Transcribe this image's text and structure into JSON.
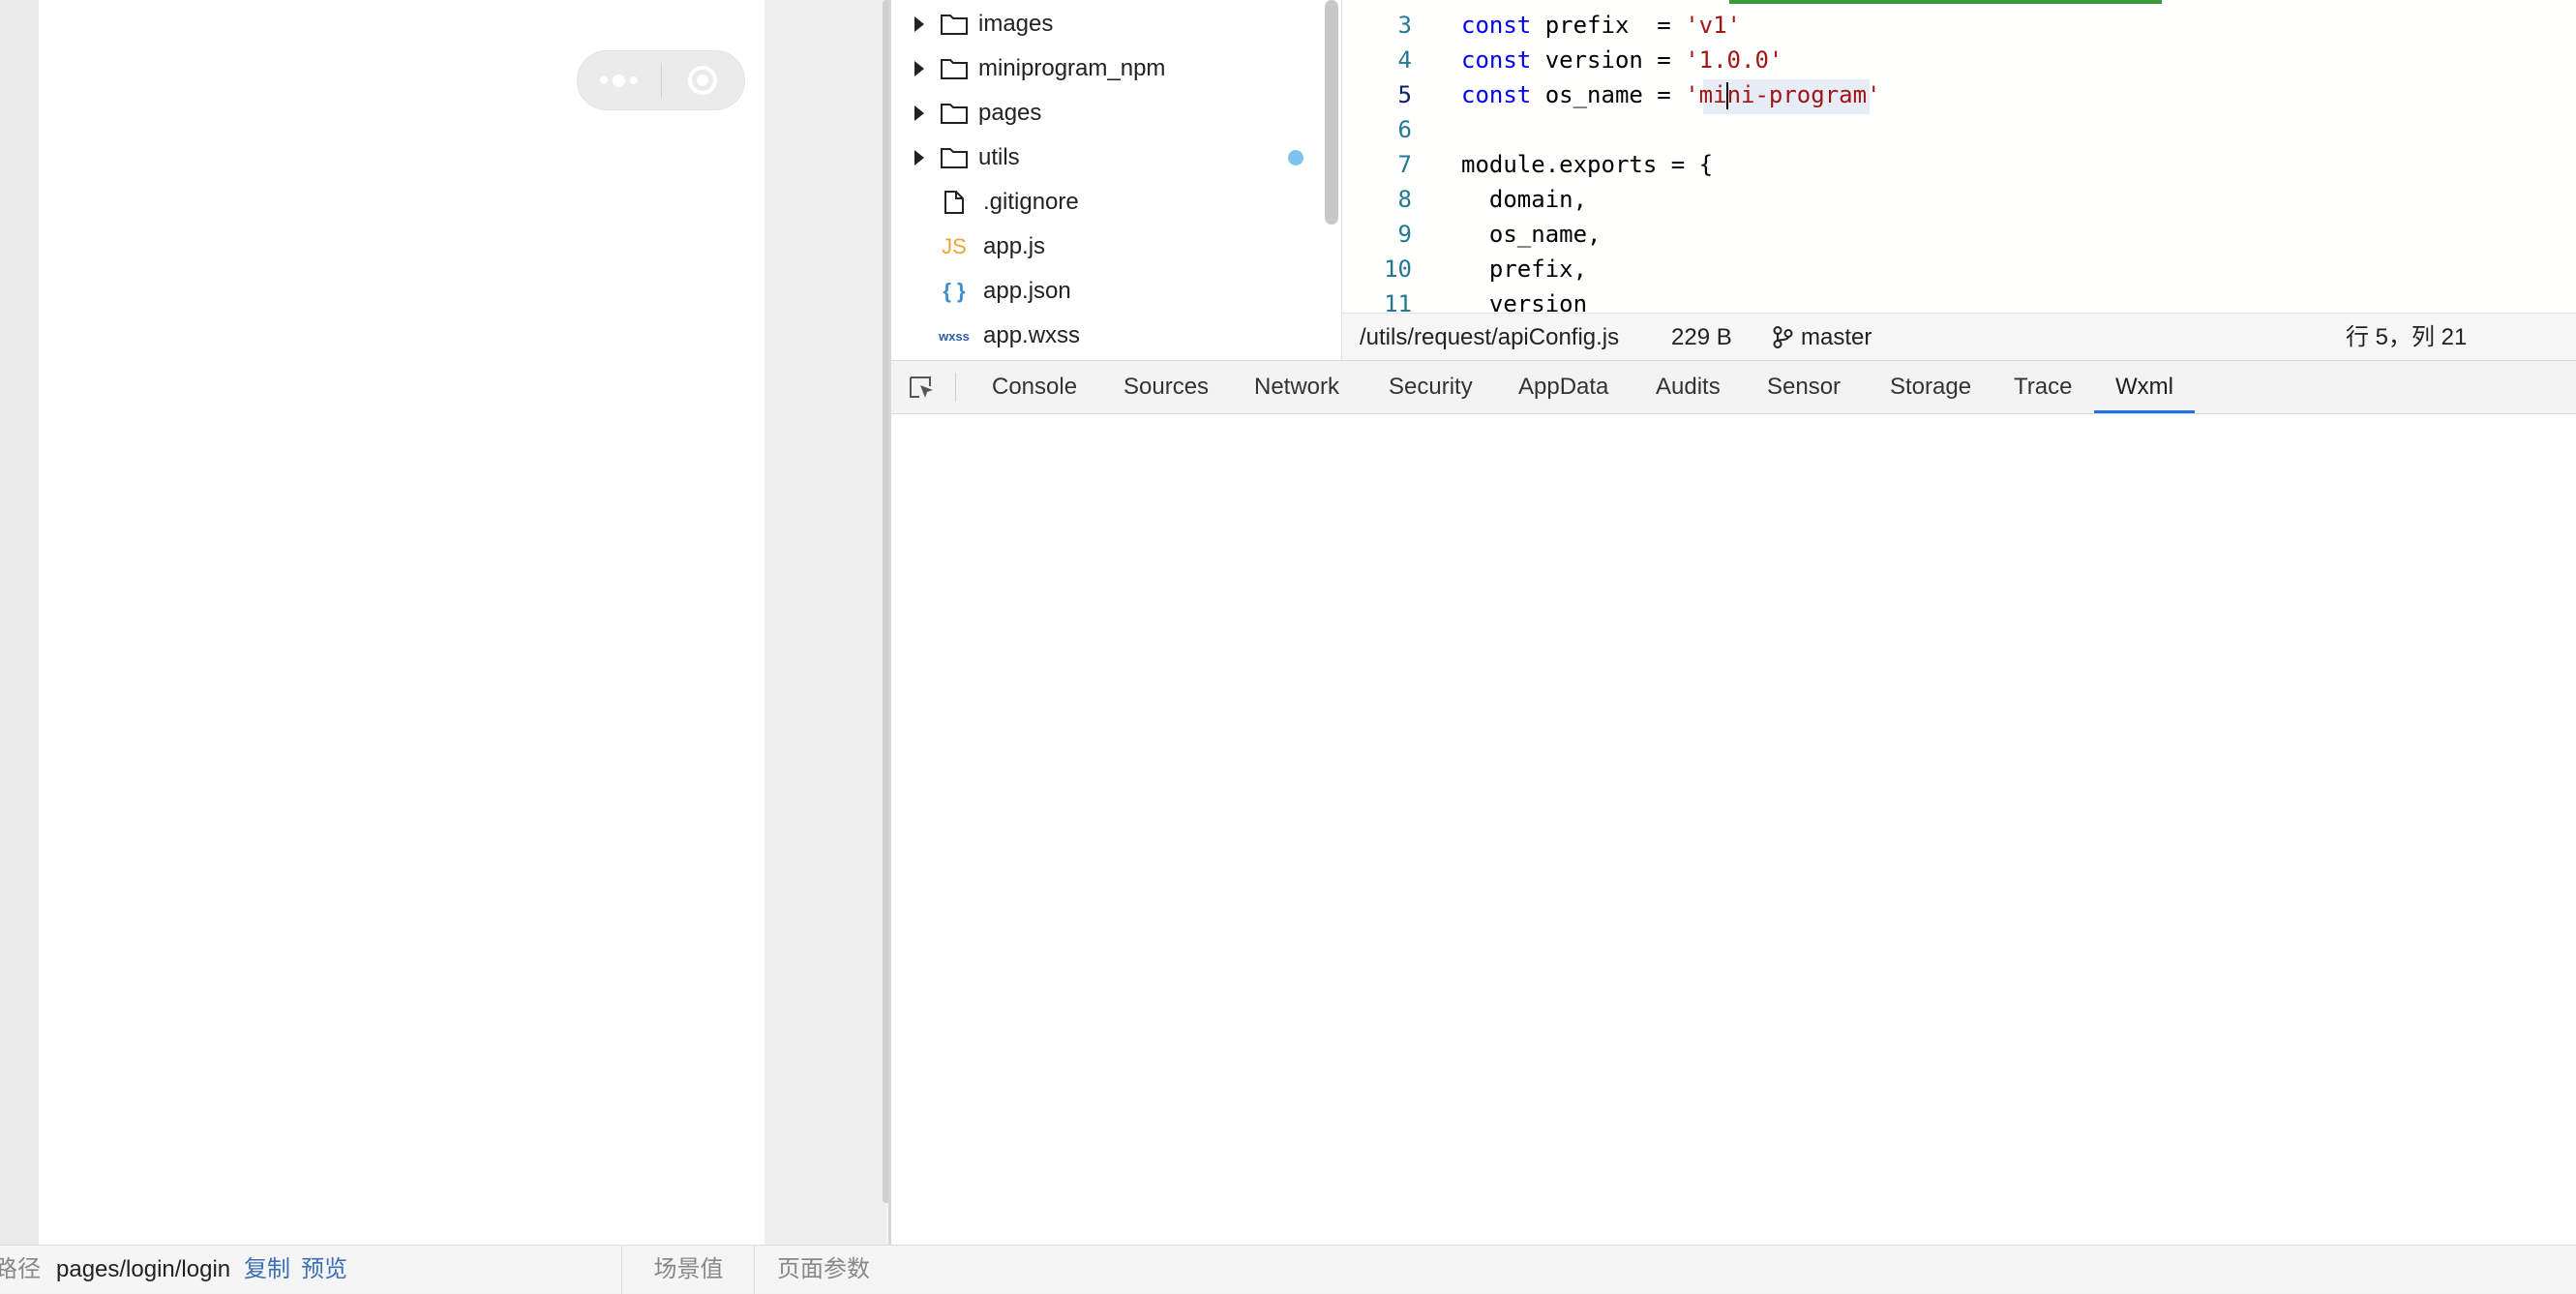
{
  "simulator": {
    "footer": {
      "path_label": "路径",
      "path_value": "pages/login/login",
      "copy_label": "复制",
      "preview_label": "预览",
      "scene_label": "场景值",
      "params_label": "页面参数"
    }
  },
  "file_tree": {
    "items": [
      {
        "label": "images",
        "kind": "folder",
        "icon": "folder-icon"
      },
      {
        "label": "miniprogram_npm",
        "kind": "folder",
        "icon": "folder-icon"
      },
      {
        "label": "pages",
        "kind": "folder",
        "icon": "folder-icon"
      },
      {
        "label": "utils",
        "kind": "folder",
        "icon": "folder-icon",
        "modified": true
      },
      {
        "label": ".gitignore",
        "kind": "file",
        "icon": "file-icon"
      },
      {
        "label": "app.js",
        "kind": "file",
        "icon": "js-file-icon",
        "icon_text": "JS"
      },
      {
        "label": "app.json",
        "kind": "file",
        "icon": "json-file-icon",
        "icon_text": "{ }"
      },
      {
        "label": "app.wxss",
        "kind": "file",
        "icon": "wxss-file-icon",
        "icon_text": "wxss"
      }
    ]
  },
  "editor": {
    "lines": [
      {
        "n": "3",
        "tokens": [
          [
            "kw",
            "const"
          ],
          [
            "",
            " prefix  = "
          ],
          [
            "str",
            "'v1'"
          ]
        ]
      },
      {
        "n": "4",
        "tokens": [
          [
            "kw",
            "const"
          ],
          [
            "",
            " version = "
          ],
          [
            "str",
            "'1.0.0'"
          ]
        ]
      },
      {
        "n": "5",
        "active": true,
        "tokens": [
          [
            "kw",
            "const"
          ],
          [
            "",
            " os_name = "
          ],
          [
            "str",
            "'mi"
          ],
          [
            "cursor",
            ""
          ],
          [
            "str",
            "ni-program'"
          ]
        ]
      },
      {
        "n": "6",
        "tokens": []
      },
      {
        "n": "7",
        "tokens": [
          [
            "",
            "module.exports = {"
          ]
        ]
      },
      {
        "n": "8",
        "tokens": [
          [
            "",
            "  domain,"
          ]
        ]
      },
      {
        "n": "9",
        "tokens": [
          [
            "",
            "  os_name,"
          ]
        ]
      },
      {
        "n": "10",
        "tokens": [
          [
            "",
            "  prefix,"
          ]
        ]
      },
      {
        "n": "11",
        "tokens": [
          [
            "",
            "  version"
          ]
        ]
      }
    ],
    "status": {
      "path": "/utils/request/apiConfig.js",
      "size": "229 B",
      "branch": "master",
      "position": "行 5，列 21"
    }
  },
  "devtools": {
    "tabs": [
      "Console",
      "Sources",
      "Network",
      "Security",
      "AppData",
      "Audits",
      "Sensor",
      "Storage",
      "Trace",
      "Wxml"
    ],
    "active_tab": "Wxml"
  },
  "colors": {
    "keyword": "#0000ff",
    "string": "#a31515",
    "line_number": "#237893",
    "link": "#3a6fb5",
    "active_tab_underline": "#1a73e8",
    "modified_dot": "#7ec3ee",
    "js_icon": "#e8a62e",
    "json_icon": "#3d8fd1",
    "wxss_icon": "#2a5ea8"
  }
}
